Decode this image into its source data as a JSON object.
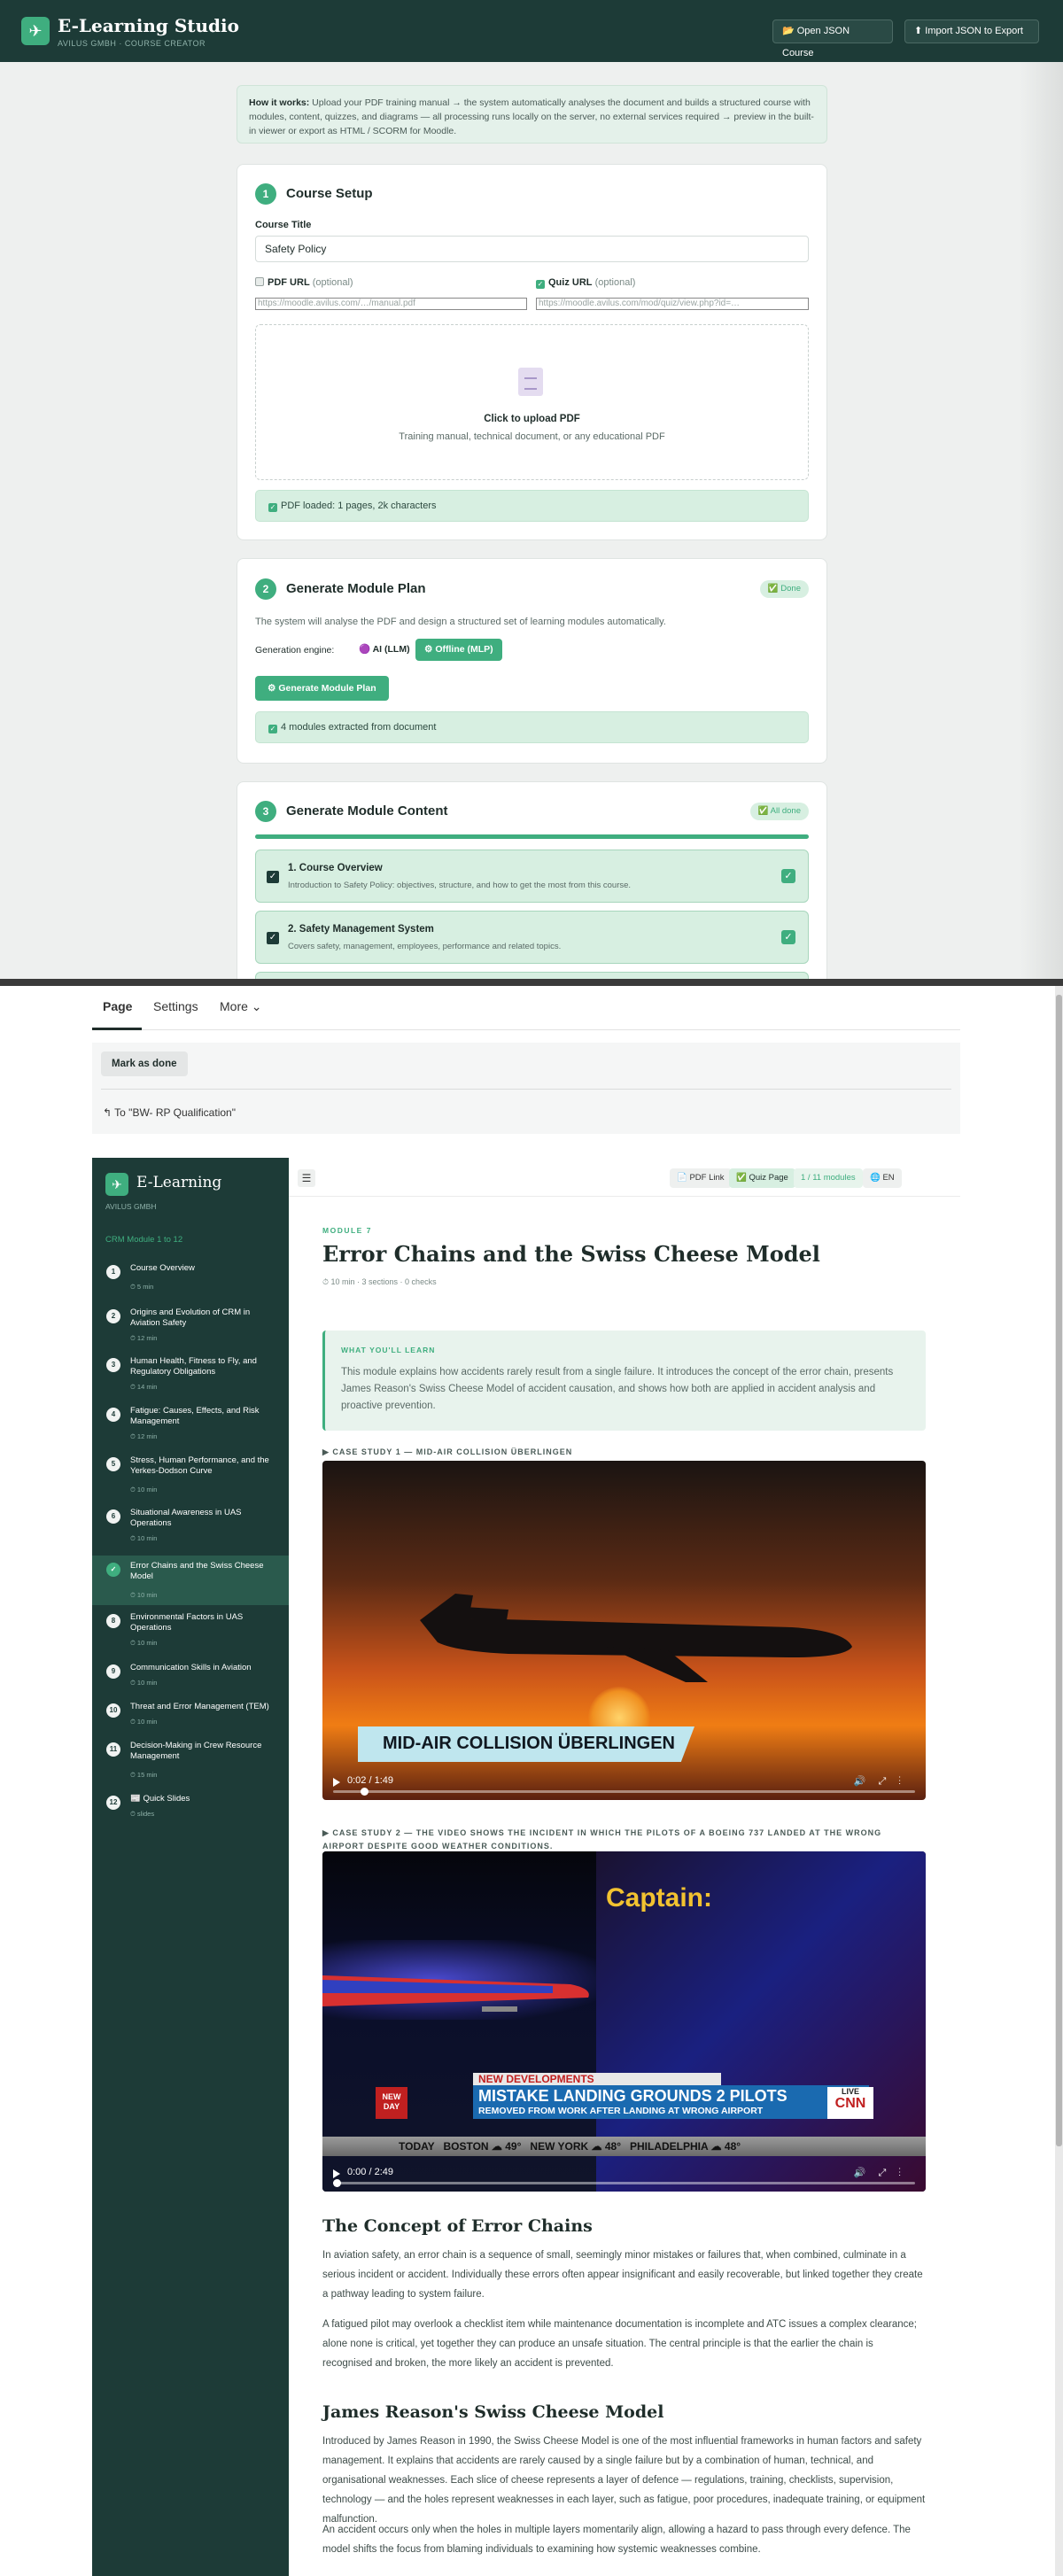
{
  "creator": {
    "app_title": "E-Learning Studio",
    "app_subtitle": "AVILUS GMBH · COURSE CREATOR",
    "open_json_label": "📂 Open JSON Course",
    "import_json_label": "⬆ Import JSON to Export",
    "howto_bold": "How it works:",
    "howto_text": " Upload your PDF training manual → the system automatically analyses the document and builds a structured course with modules, content, quizzes, and diagrams — all processing runs locally on the server, no external services required → preview in the built-in viewer or export as HTML / SCORM for Moodle.",
    "step1": {
      "num": "1",
      "title": "Course Setup",
      "course_title_label": "Course Title",
      "course_title_value": "Safety Policy",
      "pdf_url_label": "PDF URL",
      "pdf_url_optional": "(optional)",
      "pdf_url_placeholder": "https://moodle.avilus.com/…/manual.pdf",
      "quiz_url_label": "Quiz URL",
      "quiz_url_optional": "(optional)",
      "quiz_url_placeholder": "https://moodle.avilus.com/mod/quiz/view.php?id=…",
      "upload_title": "Click to upload PDF",
      "upload_sub": "Training manual, technical document, or any educational PDF",
      "loaded_msg": "PDF loaded: 1 pages, 2k characters"
    },
    "step2": {
      "num": "2",
      "title": "Generate Module Plan",
      "badge": "✅ Done",
      "desc": "The system will analyse the PDF and design a structured set of learning modules automatically.",
      "engine_label": "Generation engine:",
      "engine_ai": "🟣 AI (LLM)",
      "engine_offline": "⚙ Offline (MLP)",
      "generate_btn": "⚙ Generate Module Plan",
      "result_msg": "4 modules extracted from document"
    },
    "step3": {
      "num": "3",
      "title": "Generate Module Content",
      "badge": "✅ All done",
      "progress": 1.0,
      "modules": [
        {
          "title": "1. Course Overview",
          "desc": "Introduction to Safety Policy: objectives, structure, and how to get the most from this course."
        },
        {
          "title": "2. Safety Management System",
          "desc": "Covers safety, management, employees, performance and related topics."
        }
      ]
    }
  },
  "moodle": {
    "tabs": [
      "Page",
      "Settings",
      "More ⌄"
    ],
    "mark_done": "Mark as done",
    "back_link": "To \"BW- RP Qualification\"",
    "sidebar": {
      "title": "E-Learning",
      "subtitle": "AVILUS GMBH",
      "module_range": "CRM Module 1 to 12",
      "items": [
        {
          "num": "1",
          "label": "Course Overview",
          "meta": "⏱ 5 min"
        },
        {
          "num": "2",
          "label": "Origins and Evolution of CRM in Aviation Safety",
          "meta": "⏱ 12 min"
        },
        {
          "num": "3",
          "label": "Human Health, Fitness to Fly, and Regulatory Obligations",
          "meta": "⏱ 14 min"
        },
        {
          "num": "4",
          "label": "Fatigue: Causes, Effects, and Risk Management",
          "meta": "⏱ 12 min"
        },
        {
          "num": "5",
          "label": "Stress, Human Performance, and the Yerkes-Dodson Curve",
          "meta": "⏱ 10 min"
        },
        {
          "num": "6",
          "label": "Situational Awareness in UAS Operations",
          "meta": "⏱ 10 min"
        },
        {
          "num": "✓",
          "label": "Error Chains and the Swiss Cheese Model",
          "meta": "⏱ 10 min"
        },
        {
          "num": "8",
          "label": "Environmental Factors in UAS Operations",
          "meta": "⏱ 10 min"
        },
        {
          "num": "9",
          "label": "Communication Skills in Aviation",
          "meta": "⏱ 10 min"
        },
        {
          "num": "10",
          "label": "Threat and Error Management (TEM)",
          "meta": "⏱ 10 min"
        },
        {
          "num": "11",
          "label": "Decision-Making in Crew Resource Management",
          "meta": "⏱ 15 min"
        },
        {
          "num": "12",
          "label": "📰 Quick Slides",
          "meta": "⏱ slides"
        }
      ]
    },
    "topbar": {
      "pdf_link": "📄 PDF Link",
      "quiz_page": "✅ Quiz Page",
      "module_count": "1 / 11 modules",
      "lang": "🌐 EN"
    },
    "module": {
      "kicker": "MODULE 7",
      "title": "Error Chains and the Swiss Cheese Model",
      "meta": "⏱ 10 min · 3 sections · 0 checks",
      "learn_head": "WHAT YOU'LL LEARN",
      "learn_text": "This module explains how accidents rarely result from a single failure. It introduces the concept of the error chain, presents James Reason's Swiss Cheese Model of accident causation, and shows how both are applied in accident analysis and proactive prevention.",
      "case1_caption": "▶ CASE STUDY 1 — MID-AIR COLLISION ÜBERLINGEN",
      "video1_title": "MID-AIR COLLISION ÜBERLINGEN",
      "video1_time": "0:02 / 1:49",
      "video1_progress": 0.02,
      "case2_caption": "▶ CASE STUDY 2 — THE VIDEO SHOWS THE INCIDENT IN WHICH THE PILOTS OF A BOEING 737 LANDED AT THE WRONG AIRPORT DESPITE GOOD WEATHER CONDITIONS.",
      "video2_captain": "Captain:",
      "video2_newdev": "NEW DEVELOPMENTS",
      "video2_headline1": "MISTAKE LANDING GROUNDS 2 PILOTS",
      "video2_headline2": "REMOVED FROM WORK AFTER LANDING AT WRONG AIRPORT",
      "video2_newday": "NEW DAY",
      "video2_ticker": "TODAY   BOSTON ☁ 49°   NEW YORK ☁ 48°   PHILADELPHIA ☁ 48°",
      "video2_live": "LIVE",
      "video2_cnn": "CNN",
      "video2_time": "0:00 / 2:49",
      "video2_progress": 0.0,
      "section1_title": "The Concept of Error Chains",
      "section1_p1": "In aviation safety, an error chain is a sequence of small, seemingly minor mistakes or failures that, when combined, culminate in a serious incident or accident. Individually these errors often appear insignificant and easily recoverable, but linked together they create a pathway leading to system failure.",
      "section1_p2": "A fatigued pilot may overlook a checklist item while maintenance documentation is incomplete and ATC issues a complex clearance; alone none is critical, yet together they can produce an unsafe situation. The central principle is that the earlier the chain is recognised and broken, the more likely an accident is prevented.",
      "section2_title": "James Reason's Swiss Cheese Model",
      "section2_p1": "Introduced by James Reason in 1990, the Swiss Cheese Model is one of the most influential frameworks in human factors and safety management. It explains that accidents are rarely caused by a single failure but by a combination of human, technical, and organisational weaknesses. Each slice of cheese represents a layer of defence — regulations, training, checklists, supervision, technology — and the holes represent weaknesses in each layer, such as fatigue, poor procedures, inadequate training, or equipment malfunction.",
      "section2_p2": "An accident occurs only when the holes in multiple layers momentarily align, allowing a hazard to pass through every defence. The model shifts the focus from blaming individuals to examining how systemic weaknesses combine."
    }
  }
}
